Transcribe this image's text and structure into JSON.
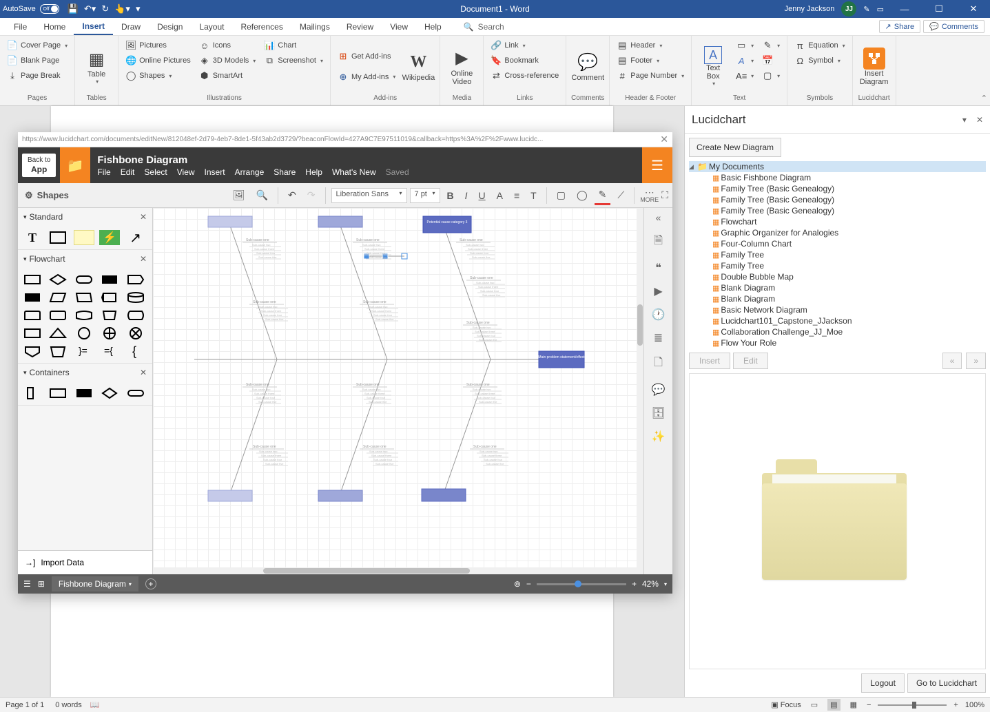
{
  "titlebar": {
    "autosave_label": "AutoSave",
    "autosave_state": "Off",
    "doc_title": "Document1 - Word",
    "user_name": "Jenny Jackson",
    "user_initials": "JJ"
  },
  "word_tabs": [
    "File",
    "Home",
    "Insert",
    "Draw",
    "Design",
    "Layout",
    "References",
    "Mailings",
    "Review",
    "View",
    "Help"
  ],
  "active_tab": "Insert",
  "search_placeholder": "Search",
  "share_label": "Share",
  "comments_label": "Comments",
  "ribbon": {
    "pages": {
      "label": "Pages",
      "cover_page": "Cover Page",
      "blank_page": "Blank Page",
      "page_break": "Page Break"
    },
    "tables": {
      "label": "Tables",
      "table": "Table"
    },
    "illustrations": {
      "label": "Illustrations",
      "pictures": "Pictures",
      "online_pictures": "Online Pictures",
      "shapes": "Shapes",
      "icons": "Icons",
      "models": "3D Models",
      "smartart": "SmartArt",
      "chart": "Chart",
      "screenshot": "Screenshot"
    },
    "addins": {
      "label": "Add-ins",
      "get": "Get Add-ins",
      "my": "My Add-ins",
      "wikipedia": "Wikipedia"
    },
    "media": {
      "label": "Media",
      "video": "Online Video"
    },
    "links": {
      "label": "Links",
      "link": "Link",
      "bookmark": "Bookmark",
      "xref": "Cross-reference"
    },
    "comments": {
      "label": "Comments",
      "comment": "Comment"
    },
    "headerfooter": {
      "label": "Header & Footer",
      "header": "Header",
      "footer": "Footer",
      "page_number": "Page Number"
    },
    "text": {
      "label": "Text",
      "text_box": "Text Box"
    },
    "symbols": {
      "label": "Symbols",
      "equation": "Equation",
      "symbol": "Symbol"
    },
    "lucidchart": {
      "label": "Lucidchart",
      "insert": "Insert Diagram"
    }
  },
  "lucid_pane": {
    "title": "Lucidchart",
    "create_new": "Create New Diagram",
    "root_folder": "My Documents",
    "documents": [
      "Basic Fishbone Diagram",
      "Family Tree (Basic Genealogy)",
      "Family Tree (Basic Genealogy)",
      "Family Tree (Basic Genealogy)",
      "Flowchart",
      "Graphic Organizer for Analogies",
      "Four-Column Chart",
      "Family Tree",
      "Family Tree",
      "Double Bubble Map",
      "Blank Diagram",
      "Blank Diagram",
      "Basic Network Diagram",
      "Lucidchart101_Capstone_JJackson",
      "Collaboration Challenge_JJ_Moe",
      "Flow Your Role"
    ],
    "insert_btn": "Insert",
    "edit_btn": "Edit",
    "prev_btn": "«",
    "next_btn": "»",
    "logout": "Logout",
    "goto": "Go to Lucidchart"
  },
  "lucid_editor": {
    "url": "https://www.lucidchart.com/documents/editNew/812048ef-2d79-4eb7-8de1-5f43ab2d3729/?beaconFlowId=427A9C7E97511019&callback=https%3A%2F%2Fwww.lucidc...",
    "back_to": "Back to",
    "app": "App",
    "doc_name": "Fishbone Diagram",
    "menus": [
      "File",
      "Edit",
      "Select",
      "View",
      "Insert",
      "Arrange",
      "Share",
      "Help",
      "What's New"
    ],
    "saved": "Saved",
    "shapes_label": "Shapes",
    "font": "Liberation Sans",
    "font_size": "7 pt",
    "more": "MORE",
    "sections": {
      "standard": "Standard",
      "flowchart": "Flowchart",
      "containers": "Containers"
    },
    "import_data": "Import Data",
    "tab_name": "Fishbone Diagram",
    "zoom": "42%",
    "cause_label": "Potential cause category 3",
    "effect_label": "Main problem statement/effect",
    "subcause_one": "Sub-cause one",
    "subcauses": [
      "Sub-cause two",
      "Sub-cause three",
      "Sub-cause four",
      "Sub-cause five"
    ]
  },
  "status": {
    "page": "Page 1 of 1",
    "words": "0 words",
    "focus": "Focus",
    "zoom": "100%"
  }
}
